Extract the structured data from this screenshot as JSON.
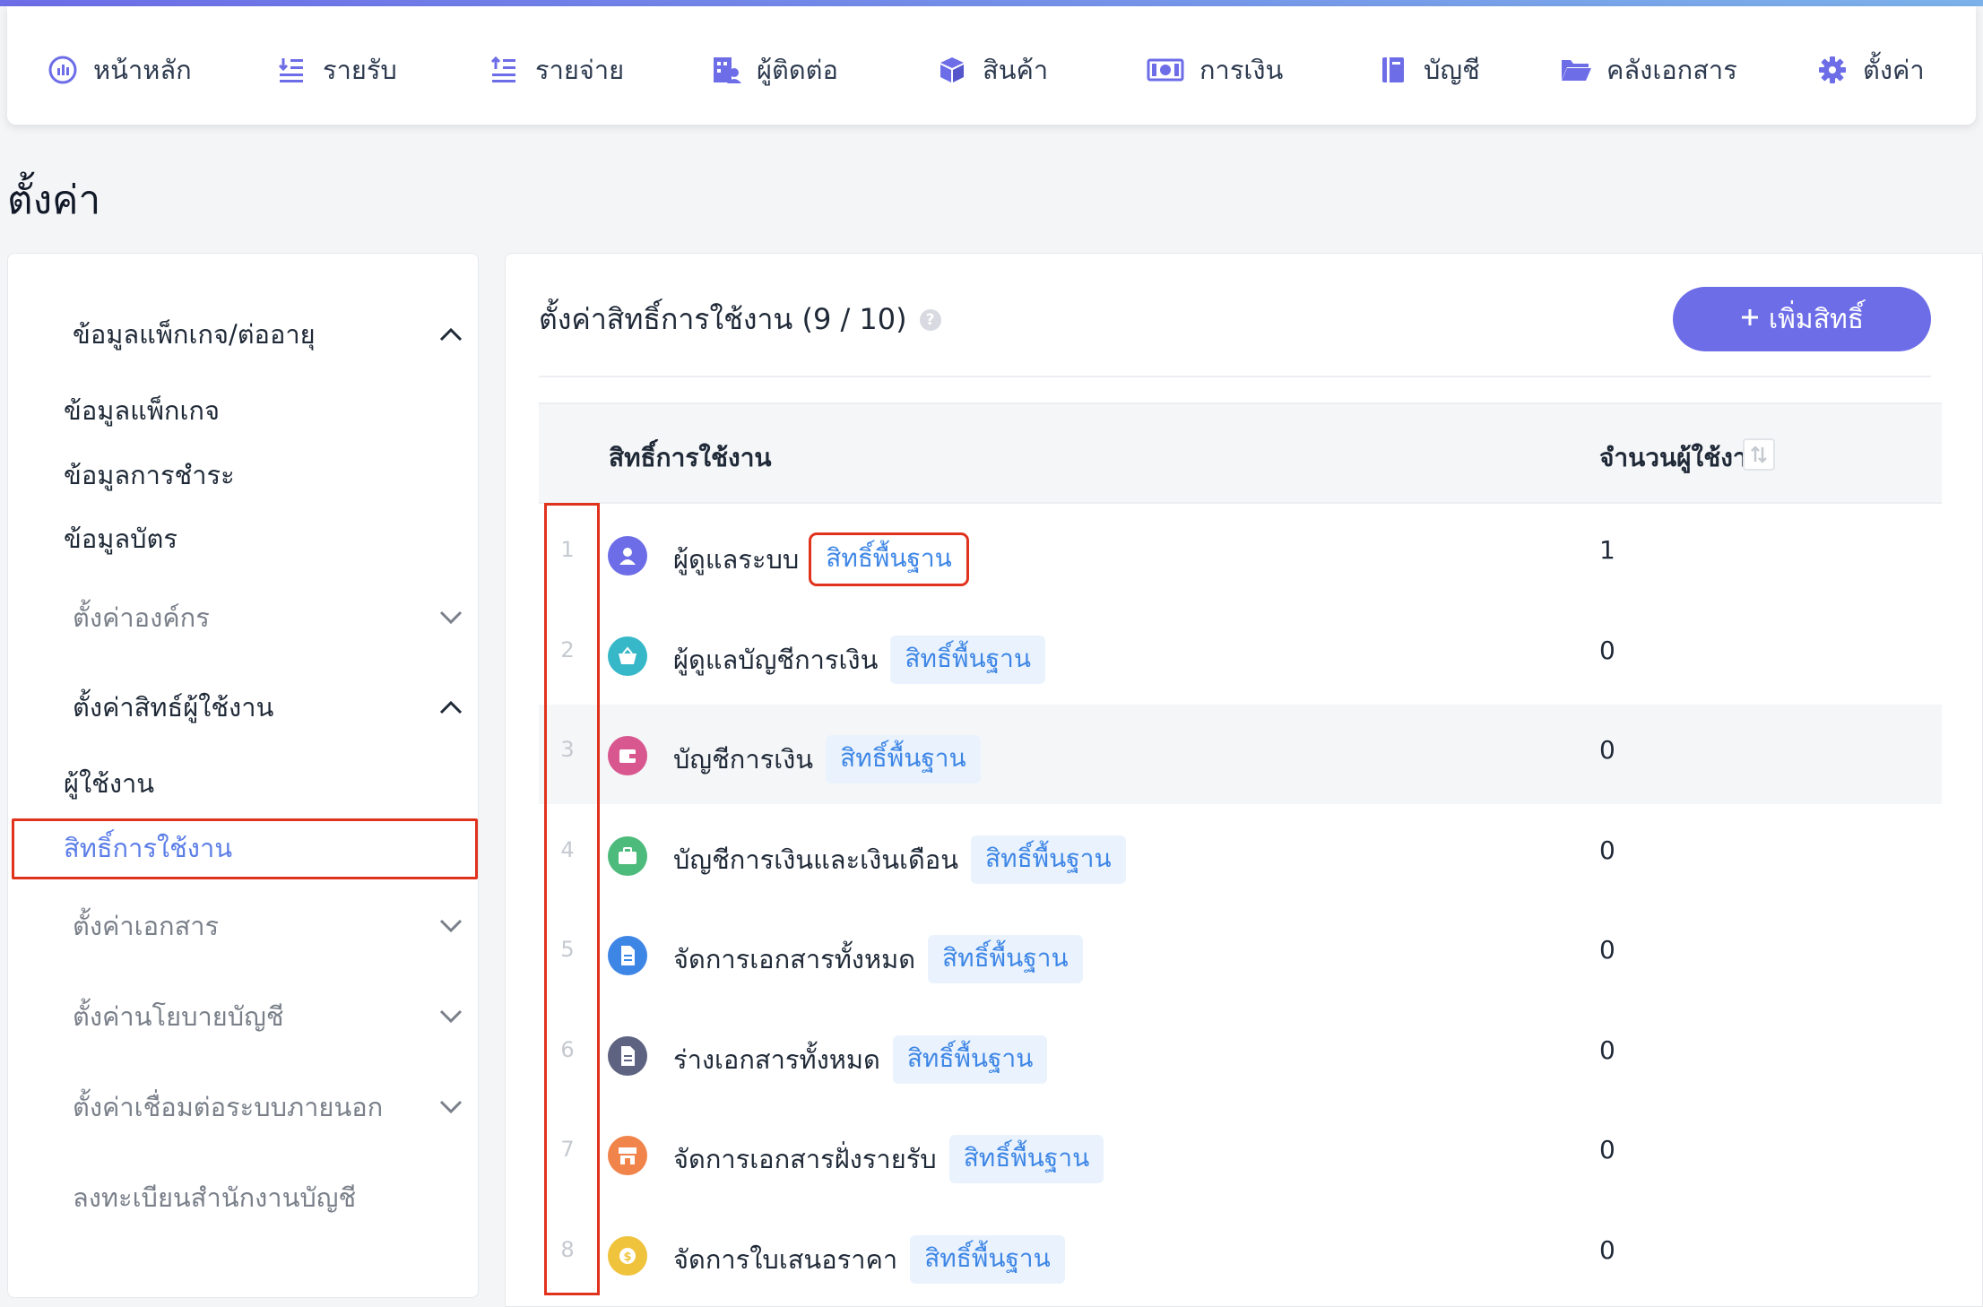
{
  "nav": {
    "items": [
      {
        "label": "หน้าหลัก",
        "icon": "dashboard-icon"
      },
      {
        "label": "รายรับ",
        "icon": "income-icon"
      },
      {
        "label": "รายจ่าย",
        "icon": "expense-icon"
      },
      {
        "label": "ผู้ติดต่อ",
        "icon": "contacts-icon"
      },
      {
        "label": "สินค้า",
        "icon": "product-box-icon"
      },
      {
        "label": "การเงิน",
        "icon": "money-icon"
      },
      {
        "label": "บัญชี",
        "icon": "ledger-book-icon"
      },
      {
        "label": "คลังเอกสาร",
        "icon": "folder-icon"
      },
      {
        "label": "ตั้งค่า",
        "icon": "gear-icon"
      }
    ]
  },
  "page": {
    "title": "ตั้งค่า"
  },
  "sidebar": {
    "group_package": "ข้อมูลแพ็กเกจ/ต่ออายุ",
    "item_package_info": "ข้อมูลแพ็กเกจ",
    "item_payment_info": "ข้อมูลการชำระ",
    "item_card_info": "ข้อมูลบัตร",
    "group_org": "ตั้งค่าองค์กร",
    "group_user_rights": "ตั้งค่าสิทธ์ผู้ใช้งาน",
    "item_users": "ผู้ใช้งาน",
    "item_permissions": "สิทธิ์การใช้งาน",
    "group_documents": "ตั้งค่าเอกสาร",
    "group_accounting_policy": "ตั้งค่านโยบายบัญชี",
    "group_integrations": "ตั้งค่าเชื่อมต่อระบบภายนอก",
    "item_register_office": "ลงทะเบียนสำนักงานบัญชี"
  },
  "main": {
    "title": "ตั้งค่าสิทธิ์การใช้งาน (9 / 10)",
    "add_button": "เพิ่มสิทธิ์",
    "col_permission": "สิทธิ์การใช้งาน",
    "col_user_count": "จำนวนผู้ใช้งาน",
    "rows": [
      {
        "num": "1",
        "name": "ผู้ดูแลระบบ",
        "badge": "สิทธิ์พื้นฐาน",
        "count": "1",
        "icon": "admin-user-icon",
        "icon_color": "#6d6de8"
      },
      {
        "num": "2",
        "name": "ผู้ดูแลบัญชีการเงิน",
        "badge": "สิทธิ์พื้นฐาน",
        "count": "0",
        "icon": "basket-icon",
        "icon_color": "#37b8c9"
      },
      {
        "num": "3",
        "name": "บัญชีการเงิน",
        "badge": "สิทธิ์พื้นฐาน",
        "count": "0",
        "icon": "wallet-icon",
        "icon_color": "#d8578f"
      },
      {
        "num": "4",
        "name": "บัญชีการเงินและเงินเดือน",
        "badge": "สิทธิ์พื้นฐาน",
        "count": "0",
        "icon": "briefcase-icon",
        "icon_color": "#4dbb7b"
      },
      {
        "num": "5",
        "name": "จัดการเอกสารทั้งหมด",
        "badge": "สิทธิ์พื้นฐาน",
        "count": "0",
        "icon": "document-icon",
        "icon_color": "#3e86e6"
      },
      {
        "num": "6",
        "name": "ร่างเอกสารทั้งหมด",
        "badge": "สิทธิ์พื้นฐาน",
        "count": "0",
        "icon": "draft-document-icon",
        "icon_color": "#5d6381"
      },
      {
        "num": "7",
        "name": "จัดการเอกสารฝั่งรายรับ",
        "badge": "สิทธิ์พื้นฐาน",
        "count": "0",
        "icon": "storefront-icon",
        "icon_color": "#f0844a"
      },
      {
        "num": "8",
        "name": "จัดการใบเสนอราคา",
        "badge": "สิทธิ์พื้นฐาน",
        "count": "0",
        "icon": "dollar-coin-icon",
        "icon_color": "#f0c33c"
      }
    ]
  },
  "colors": {
    "accent": "#6d6de8",
    "link": "#3e86e6",
    "highlight": "#e0321d"
  }
}
